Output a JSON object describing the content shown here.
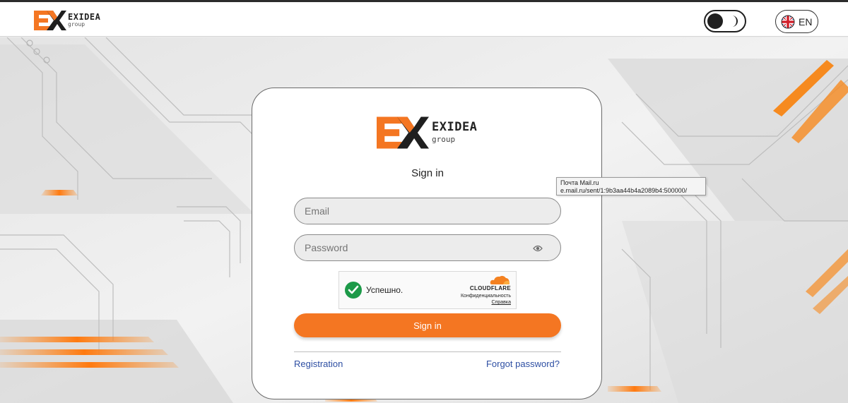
{
  "header": {
    "brand": "EXIDEA",
    "brand_sub": "group",
    "theme_toggle_icon": "moon-icon",
    "language": "EN",
    "language_icon": "uk-flag-icon"
  },
  "login_card": {
    "brand": "EXIDEA",
    "brand_sub": "group",
    "title": "Sign in",
    "email_placeholder": "Email",
    "password_placeholder": "Password",
    "password_toggle_icon": "eye-icon",
    "captcha": {
      "status": "Успешно.",
      "provider": "CLOUDFLARE",
      "privacy": "Конфиденциальность",
      "help": "Справка"
    },
    "submit_label": "Sign in",
    "registration_link": "Registration",
    "forgot_link": "Forgot password?"
  },
  "tooltip": {
    "line1": "Почта Mail.ru",
    "line2": "e.mail.ru/sent/1:9b3aa44b4a2089b4:500000/"
  },
  "colors": {
    "accent": "#f47622",
    "link": "#2e4fa3",
    "captcha_success": "#1d9a49"
  }
}
